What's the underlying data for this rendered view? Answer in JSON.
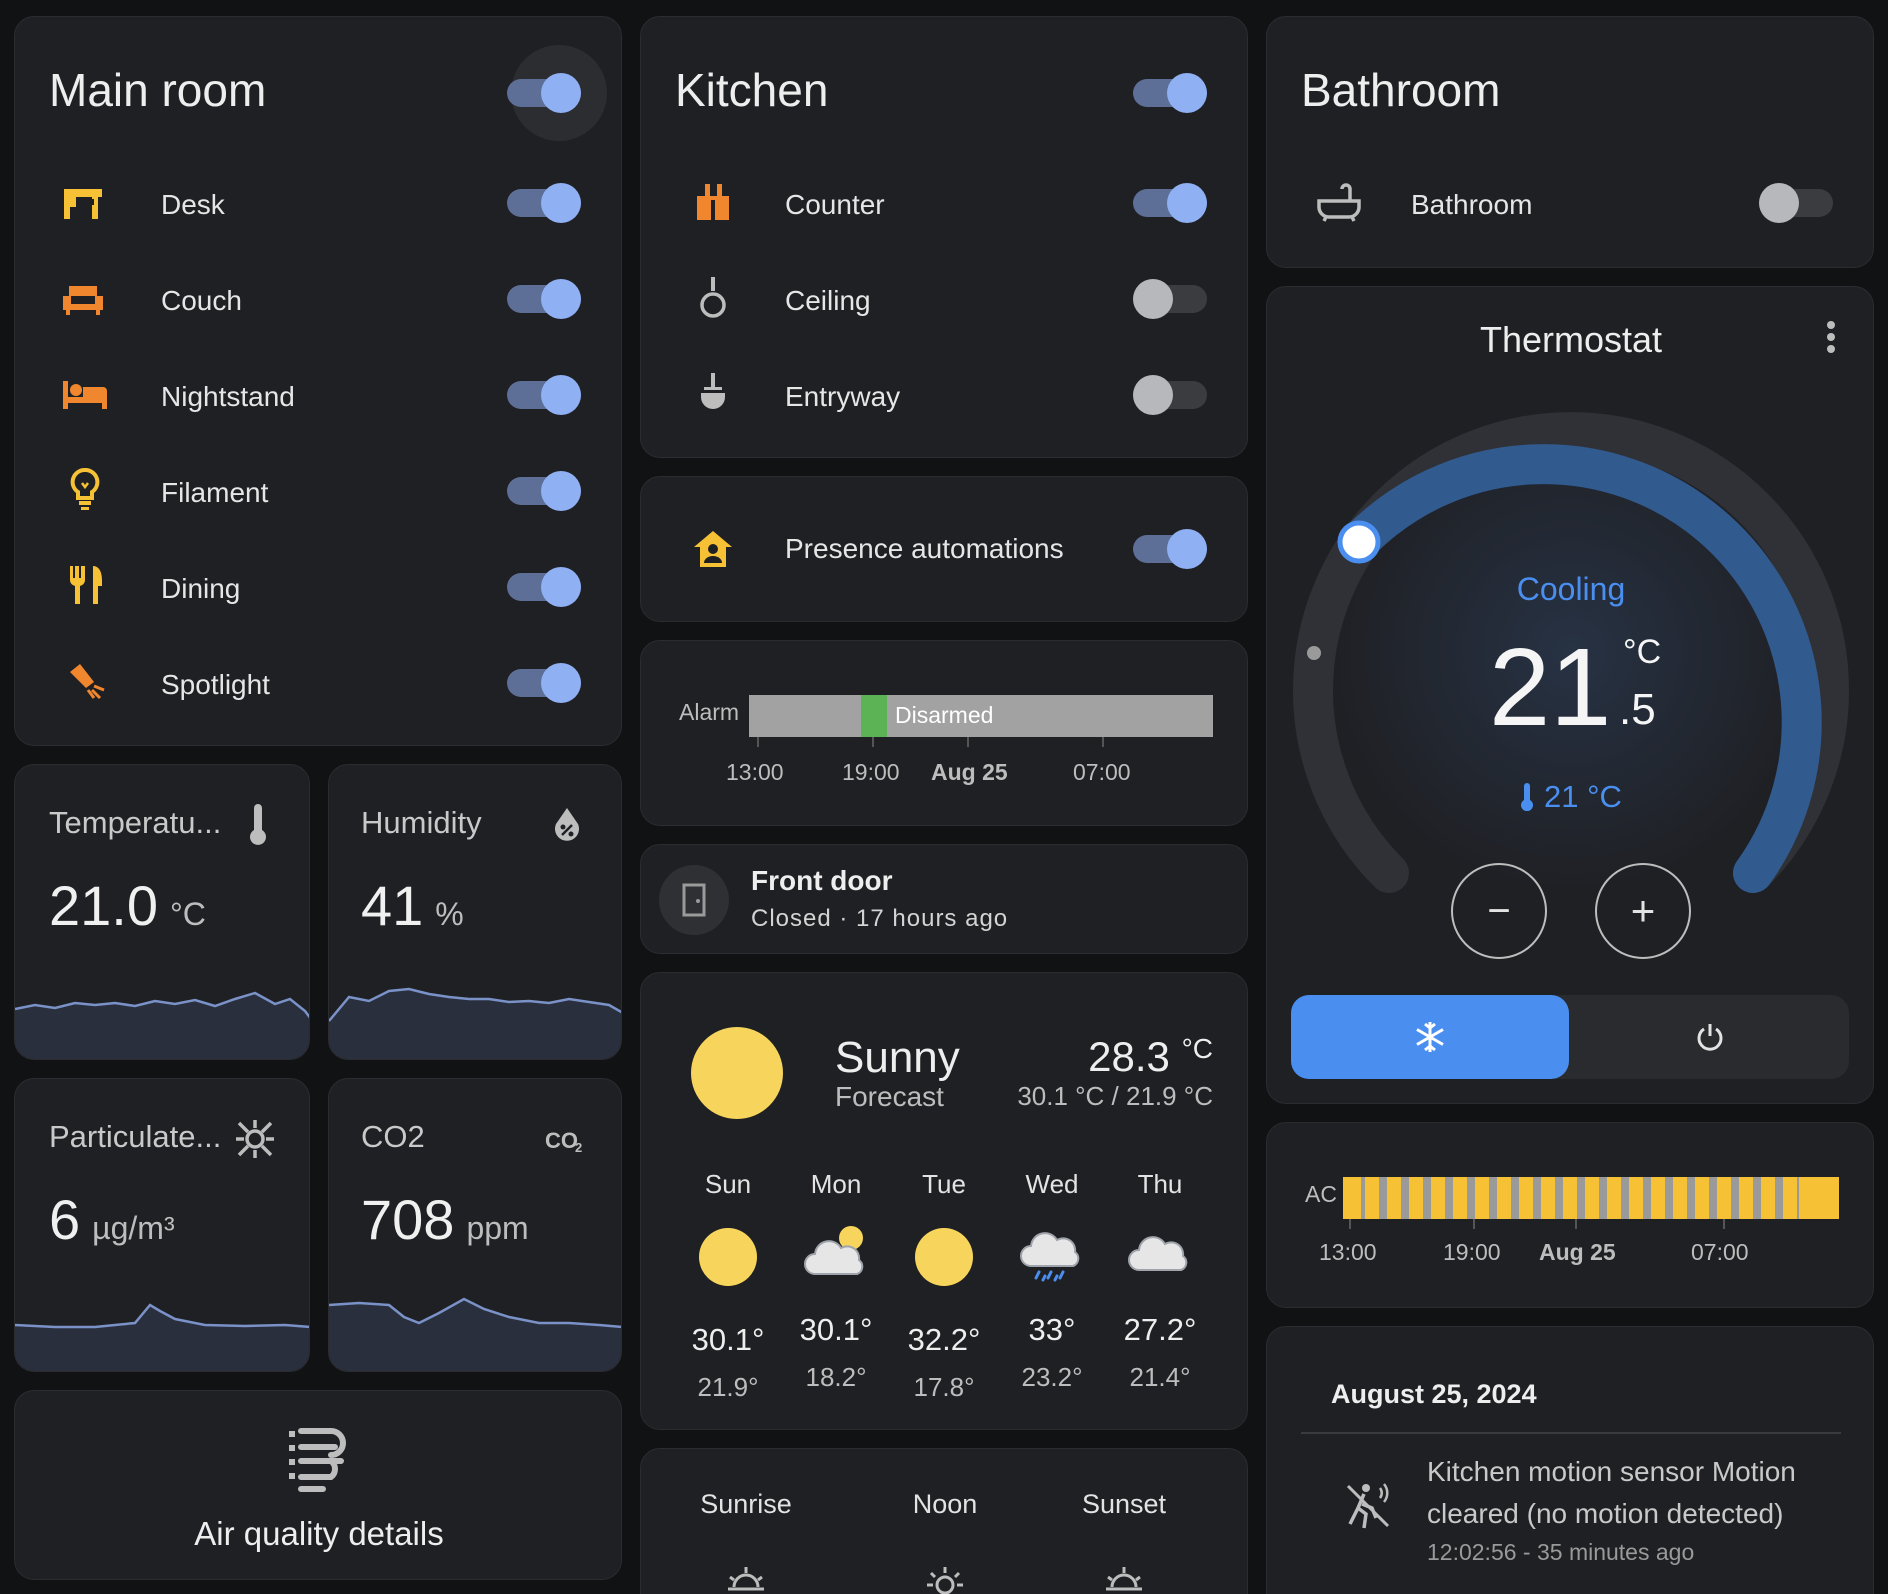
{
  "main_room": {
    "title": "Main room",
    "items": [
      {
        "label": "Desk",
        "icon": "desk-icon",
        "state": "on"
      },
      {
        "label": "Couch",
        "icon": "couch-icon",
        "state": "on"
      },
      {
        "label": "Nightstand",
        "icon": "bed-icon",
        "state": "on"
      },
      {
        "label": "Filament",
        "icon": "lightbulb-icon",
        "state": "on"
      },
      {
        "label": "Dining",
        "icon": "fork-knife-icon",
        "state": "on"
      },
      {
        "label": "Spotlight",
        "icon": "spotlight-icon",
        "state": "on"
      }
    ]
  },
  "kitchen": {
    "title": "Kitchen",
    "items": [
      {
        "label": "Counter",
        "icon": "counter-icon",
        "state": "on"
      },
      {
        "label": "Ceiling",
        "icon": "ceiling-light-icon",
        "state": "off"
      },
      {
        "label": "Entryway",
        "icon": "pendant-light-icon",
        "state": "off"
      }
    ]
  },
  "presence": {
    "label": "Presence automations",
    "icon": "home-account-icon",
    "state": "on"
  },
  "alarm": {
    "label": "Alarm",
    "state_text": "Disarmed",
    "ticks": [
      "13:00",
      "19:00",
      "Aug 25",
      "07:00"
    ]
  },
  "front_door": {
    "name": "Front door",
    "status": "Closed · 17 hours ago",
    "icon": "door-icon"
  },
  "weather": {
    "condition": "Sunny",
    "subtitle": "Forecast",
    "temp": "28.3",
    "temp_unit": "°C",
    "range": "30.1 °C / 21.9 °C",
    "days": [
      {
        "day": "Sun",
        "icon": "sunny-icon",
        "high": "30.1°",
        "low": "21.9°"
      },
      {
        "day": "Mon",
        "icon": "partly-cloudy-icon",
        "high": "30.1°",
        "low": "18.2°"
      },
      {
        "day": "Tue",
        "icon": "sunny-icon",
        "high": "32.2°",
        "low": "17.8°"
      },
      {
        "day": "Wed",
        "icon": "rainy-icon",
        "high": "33°",
        "low": "23.2°"
      },
      {
        "day": "Thu",
        "icon": "cloudy-icon",
        "high": "27.2°",
        "low": "21.4°"
      }
    ]
  },
  "sun_times": {
    "labels": [
      "Sunrise",
      "Noon",
      "Sunset"
    ]
  },
  "sensors": {
    "temperature": {
      "name": "Temperatu...",
      "value": "21.0",
      "unit": "°C"
    },
    "humidity": {
      "name": "Humidity",
      "value": "41",
      "unit": "%"
    },
    "particulate": {
      "name": "Particulate...",
      "value": "6",
      "unit": "µg/m³"
    },
    "co2": {
      "name": "CO2",
      "value": "708",
      "unit": "ppm"
    }
  },
  "air_quality": {
    "label": "Air quality details"
  },
  "bathroom": {
    "title": "Bathroom",
    "item": {
      "label": "Bathroom",
      "icon": "bathtub-icon",
      "state": "off"
    }
  },
  "thermostat": {
    "title": "Thermostat",
    "mode_text": "Cooling",
    "target_int": "21",
    "target_dec": ".5",
    "unit": "°C",
    "current": "21 °C",
    "minus": "−",
    "plus": "+"
  },
  "ac_timeline": {
    "label": "AC",
    "ticks": [
      "13:00",
      "19:00",
      "Aug 25",
      "07:00"
    ]
  },
  "logbook": {
    "date": "August 25, 2024",
    "entry_text": "Kitchen motion sensor Motion cleared (no motion detected)",
    "entry_time": "12:02:56 - 35 minutes ago"
  },
  "colors": {
    "accent_blue": "#4a8ff0",
    "toggle_on": "#8fb0f3",
    "icon_orange": "#f0872e",
    "icon_yellow": "#f6c135",
    "sun_yellow": "#f7d55c",
    "alarm_gray": "#a2a2a2",
    "alarm_green": "#5cb356",
    "ac_yellow": "#f6c135"
  }
}
